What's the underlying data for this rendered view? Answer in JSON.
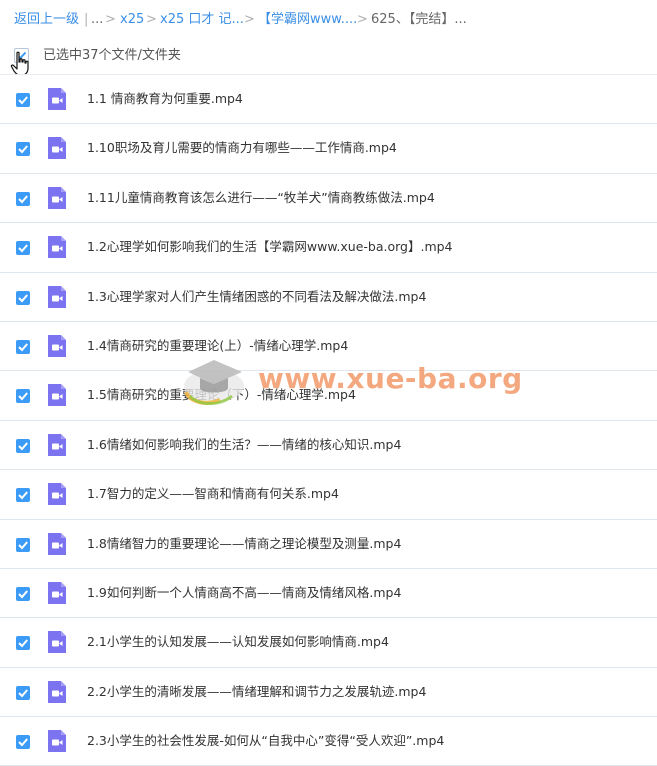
{
  "breadcrumb": {
    "back": "返回上一级",
    "items": [
      "...",
      "x25",
      "x25 口才 记...",
      "【学霸网www....",
      "625、【完结】..."
    ]
  },
  "selection": {
    "label": "已选中37个文件/文件夹"
  },
  "files": [
    "1.1 情商教育为何重要.mp4",
    "1.10职场及育儿需要的情商力有哪些——工作情商.mp4",
    "1.11儿童情商教育该怎么进行——“牧羊犬”情商教练做法.mp4",
    "1.2心理学如何影响我们的生活【学霸网www.xue-ba.org】.mp4",
    "1.3心理学家对人们产生情绪困惑的不同看法及解决做法.mp4",
    "1.4情商研究的重要理论(上）-情绪心理学.mp4",
    "1.5情商研究的重要理论（下）-情绪心理学.mp4",
    "1.6情绪如何影响我们的生活？——情绪的核心知识.mp4",
    "1.7智力的定义——智商和情商有何关系.mp4",
    "1.8情绪智力的重要理论——情商之理论模型及测量.mp4",
    "1.9如何判断一个人情商高不高——情商及情绪风格.mp4",
    "2.1小学生的认知发展——认知发展如何影响情商.mp4",
    "2.2小学生的清晰发展——情绪理解和调节力之发展轨迹.mp4",
    "2.3小学生的社会性发展-如何从“自我中心”变得“受人欢迎”.mp4"
  ],
  "watermark": {
    "text": "www.xue-ba.org"
  },
  "colors": {
    "accent": "#3b9bf7",
    "video_icon": "#7b73f0",
    "link": "#3a8ee6",
    "watermark": "#f29a6a"
  },
  "icons": {
    "file": "video-file-icon",
    "check": "checkbox-icon"
  }
}
